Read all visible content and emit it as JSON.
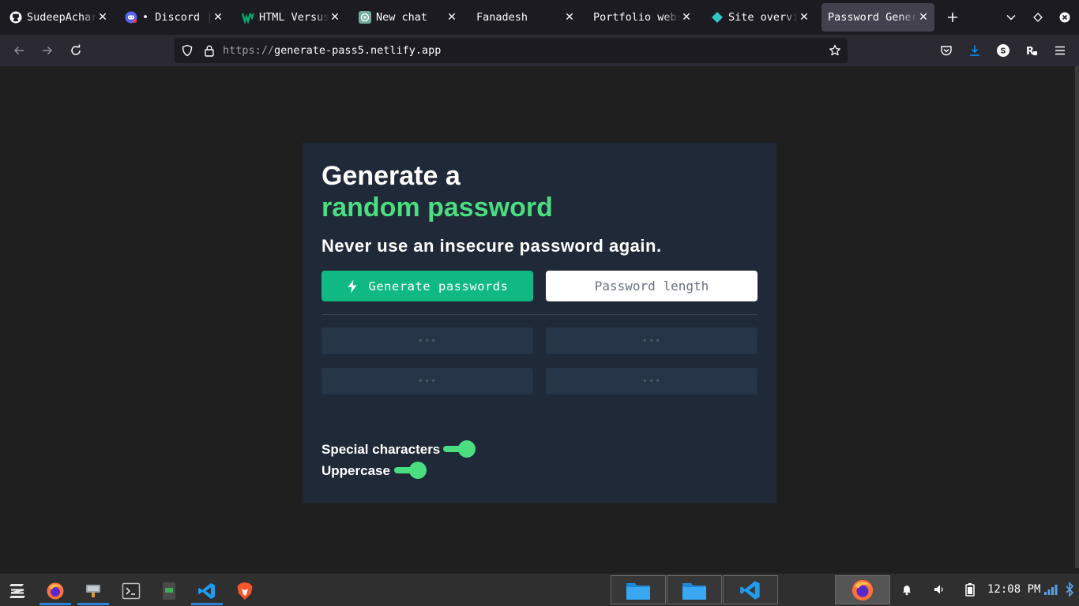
{
  "tabs": [
    {
      "title": "SudeepAcharya",
      "icon": "github-icon",
      "active": false
    },
    {
      "title": "• Discord | ",
      "icon": "discord-icon",
      "active": false
    },
    {
      "title": "HTML Versus",
      "icon": "w3schools-icon",
      "active": false
    },
    {
      "title": "New chat",
      "icon": "chatgpt-icon",
      "active": false
    },
    {
      "title": "Fanadesh",
      "icon": "",
      "active": false
    },
    {
      "title": "Portfolio webs",
      "icon": "",
      "active": false
    },
    {
      "title": "Site overview",
      "icon": "netlify-icon",
      "active": false
    },
    {
      "title": "Password Generator",
      "icon": "",
      "active": true
    }
  ],
  "url": {
    "protocol": "https://",
    "host": "generate-pass5.netlify.app"
  },
  "card": {
    "title_line1": "Generate a",
    "title_line2": "random password",
    "subtitle": "Never use an insecure password again.",
    "generate_label": "Generate passwords",
    "length_placeholder": "Password length",
    "passwords": [
      "•••",
      "•••",
      "•••",
      "•••"
    ],
    "options": [
      {
        "label": "Special characters",
        "enabled": true
      },
      {
        "label": "Uppercase",
        "enabled": true
      }
    ]
  },
  "taskbar": {
    "clock": "12:08 PM"
  },
  "colors": {
    "accent_green": "#4ade80",
    "button_green": "#10b981",
    "card_bg": "#1f2937",
    "page_bg": "#1f1f1f"
  }
}
